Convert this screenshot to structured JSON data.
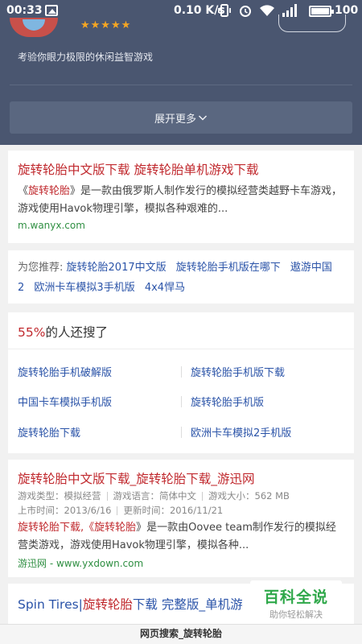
{
  "status_bar": {
    "time": "00:33",
    "speed": "0.10 K/s",
    "battery": "100"
  },
  "app": {
    "stars": "★★★★★",
    "description": "考验你眼力极限的休闲益智游戏",
    "more_label": "展开更多"
  },
  "result1": {
    "title_a": "旋转轮胎",
    "title_b": "中文版下载 ",
    "title_c": "旋转轮胎",
    "title_d": "单机游戏下载",
    "snippet_a": "《",
    "snippet_hl": "旋转轮胎",
    "snippet_b": "》是一款由俄罗斯人制作发行的模拟经营类越野卡车游戏，游戏使用Havok物理引擎，模拟各种艰难的...",
    "url": "m.wanyx.com"
  },
  "recommend": {
    "label": "为您推荐:",
    "links": [
      "旋转轮胎2017中文版",
      "旋转轮胎手机版在哪下",
      "遨游中国2",
      "欧洲卡车模拟3手机版",
      "4x4悍马"
    ]
  },
  "also_search": {
    "percent": "55%",
    "heading": "的人还搜了",
    "items": [
      "旋转轮胎手机破解版",
      "旋转轮胎手机版下载",
      "中国卡车模拟手机版",
      "旋转轮胎手机版",
      "旋转轮胎下载",
      "欧洲卡车模拟2手机版"
    ]
  },
  "result2": {
    "title": "旋转轮胎中文版下载_旋转轮胎下载_游迅网",
    "meta1": [
      "游戏类型：模拟经营",
      "游戏语言：简体中文",
      "游戏大小：562 MB"
    ],
    "meta2": [
      "上市时间：2013/6/16",
      "更新时间：2016/11/21"
    ],
    "snippet_a": "旋转轮胎下载,《",
    "snippet_hl": "旋转轮胎",
    "snippet_b": "》是一款由Oovee team制作发行的模拟经营类游戏，游戏使用Havok物理引擎，模拟各种...",
    "url": "游迅网 - www.yxdown.com"
  },
  "result3": {
    "title_a": "Spin Tires|",
    "title_b": "旋转轮胎",
    "title_c": "下载 完整版_单机游"
  },
  "watermark": {
    "title": "百科全说",
    "subtitle": "助你轻松解决"
  },
  "bottom_bar": {
    "label": "网页搜索_旋转轮胎"
  },
  "colors": {
    "header_bg": "#4a5670",
    "title_red": "#c0282d",
    "link_blue": "#2a53a8",
    "url_green": "#2f8f42",
    "watermark_green": "#2fa84a"
  }
}
